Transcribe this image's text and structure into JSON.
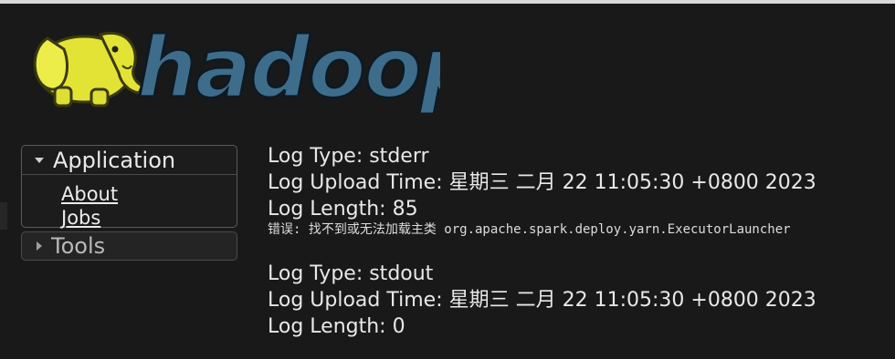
{
  "logo": {
    "text": "hadoop"
  },
  "sidebar": {
    "application": {
      "title": "Application",
      "links": [
        {
          "label": "About"
        },
        {
          "label": "Jobs"
        }
      ]
    },
    "tools": {
      "title": "Tools"
    }
  },
  "logs": [
    {
      "type_line": "Log Type: stderr",
      "upload_line": "Log Upload Time: 星期三 二月 22 11:05:30 +0800 2023",
      "length_line": "Log Length: 85",
      "content": "错误: 找不到或无法加载主类 org.apache.spark.deploy.yarn.ExecutorLauncher"
    },
    {
      "type_line": "Log Type: stdout",
      "upload_line": "Log Upload Time: 星期三 二月 22 11:05:30 +0800 2023",
      "length_line": "Log Length: 0",
      "content": ""
    }
  ],
  "colors": {
    "background": "#191919",
    "logo_text": "#3f6f8f",
    "logo_elephant": "#e6e63c"
  }
}
